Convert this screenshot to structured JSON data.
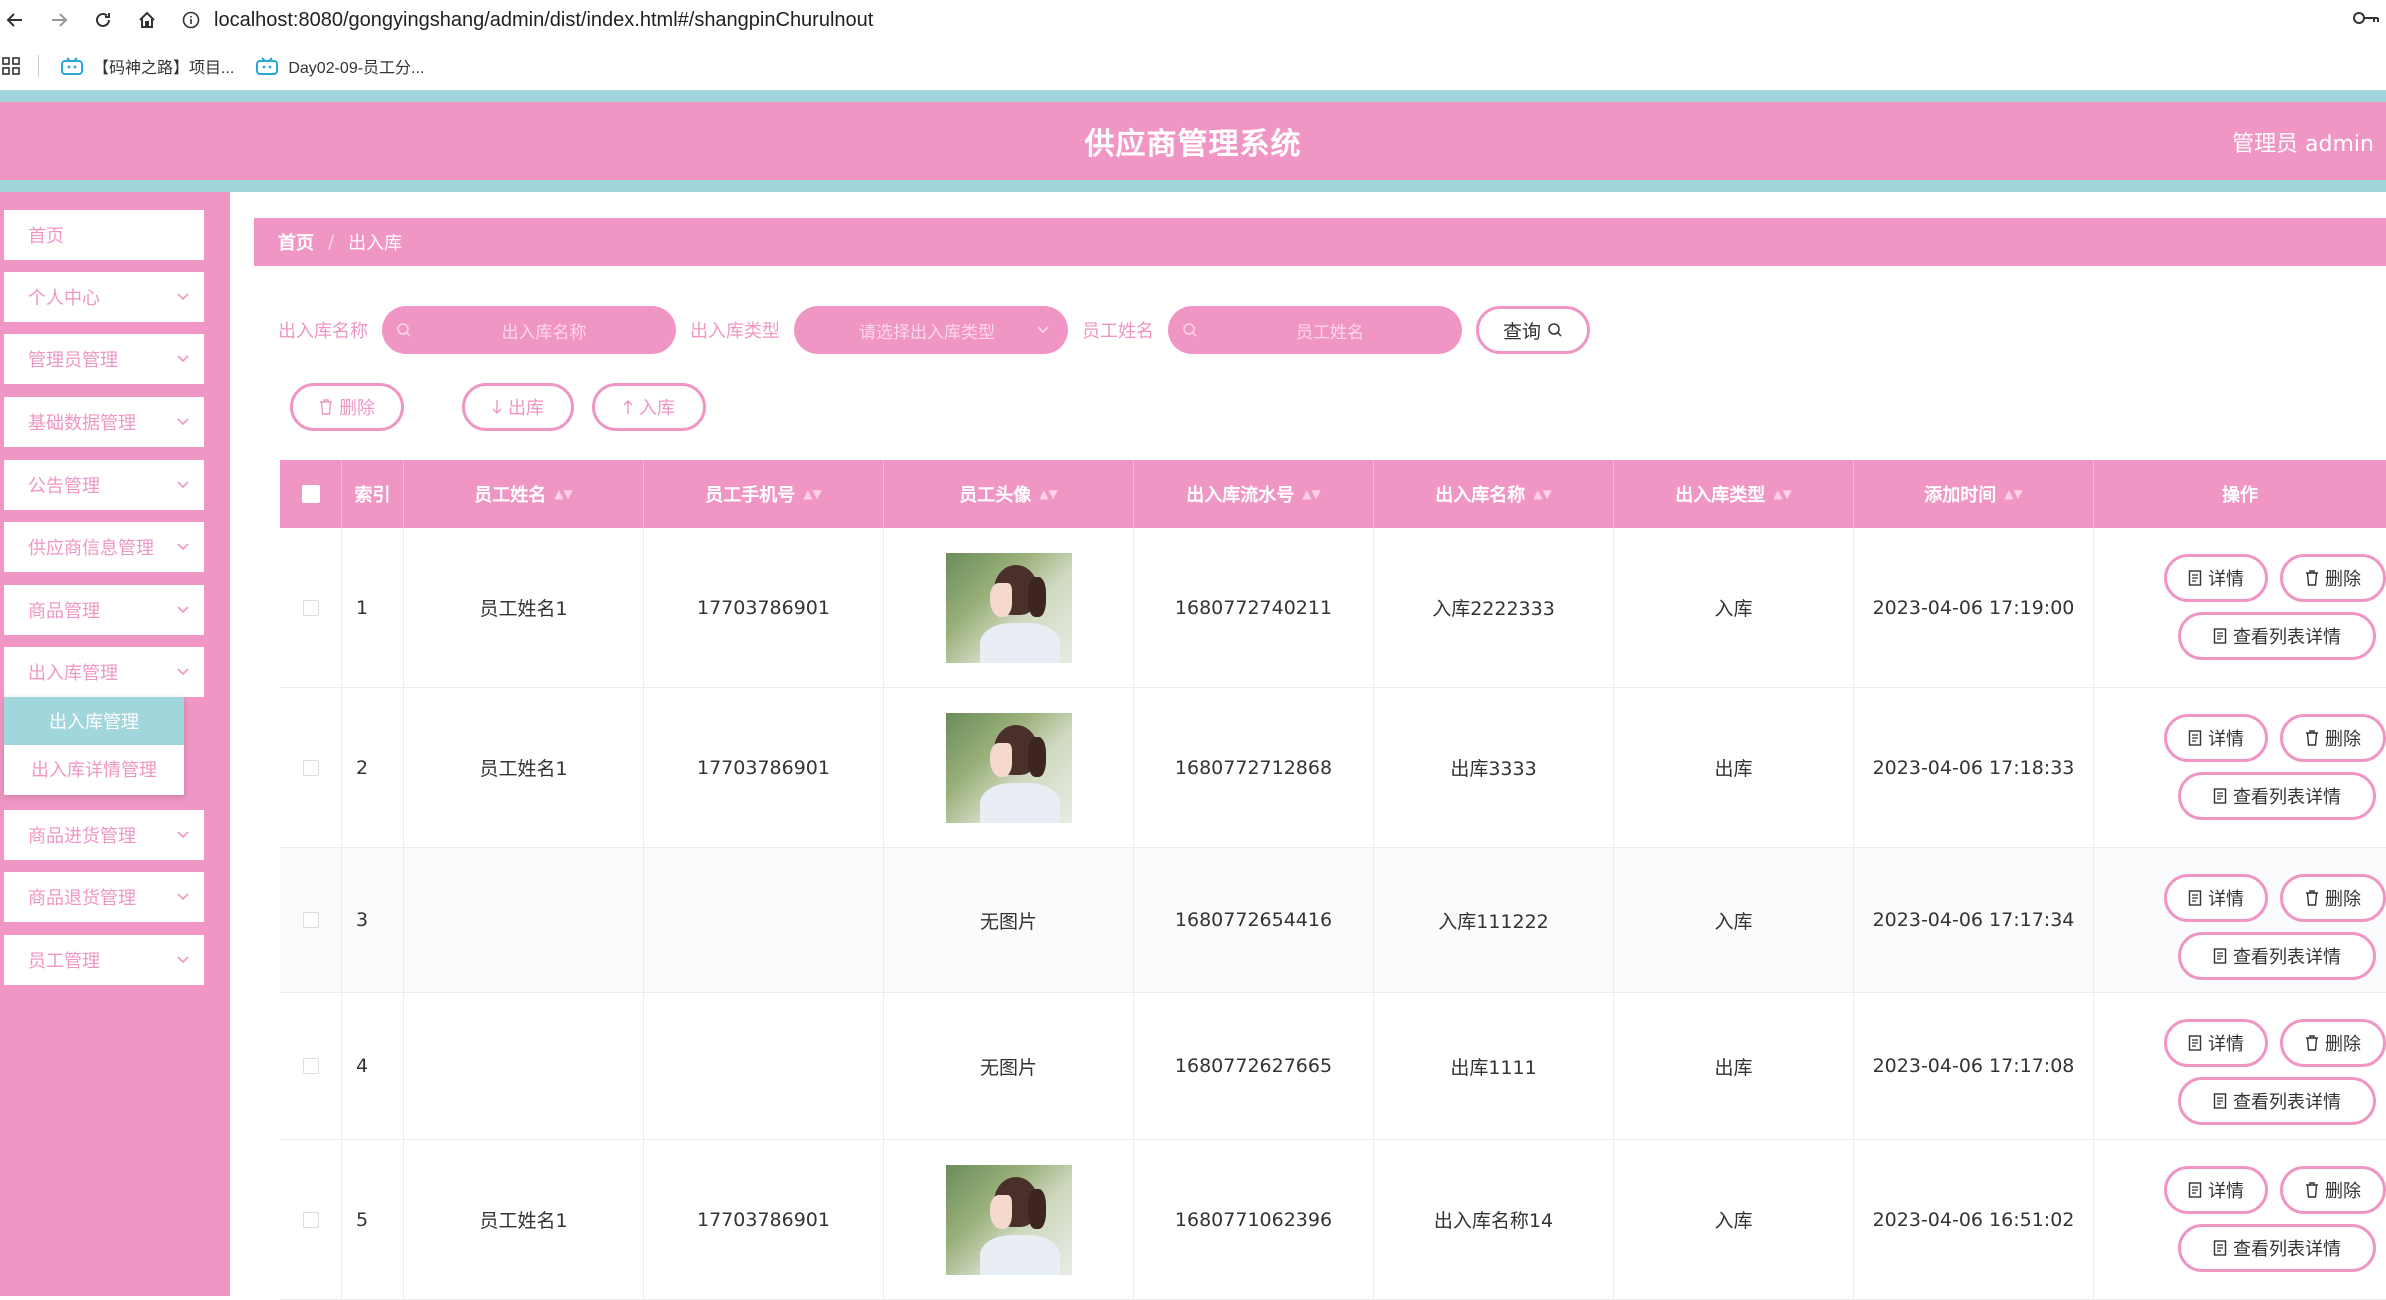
{
  "browser": {
    "url": "localhost:8080/gongyingshang/admin/dist/index.html#/shangpinChurulnout",
    "bookmarks": [
      "【码神之路】项目...",
      "Day02-09-员工分..."
    ]
  },
  "header": {
    "title": "供应商管理系统",
    "admin": "管理员 admin"
  },
  "sidebar": {
    "items": [
      "首页",
      "个人中心",
      "管理员管理",
      "基础数据管理",
      "公告管理",
      "供应商信息管理",
      "商品管理",
      "出入库管理",
      "商品进货管理",
      "商品退货管理",
      "员工管理"
    ],
    "submenu": [
      "出入库管理",
      "出入库详情管理"
    ]
  },
  "breadcrumb": {
    "home": "首页",
    "sep": "/",
    "current": "出入库"
  },
  "search": {
    "name_label": "出入库名称",
    "name_placeholder": "出入库名称",
    "type_label": "出入库类型",
    "type_placeholder": "请选择出入库类型",
    "staff_label": "员工姓名",
    "staff_placeholder": "员工姓名",
    "query_label": "查询"
  },
  "actions": {
    "delete": "删除",
    "out": "出库",
    "in": "入库"
  },
  "table": {
    "headers": [
      "索引",
      "员工姓名",
      "员工手机号",
      "员工头像",
      "出入库流水号",
      "出入库名称",
      "出入库类型",
      "添加时间",
      "操作"
    ],
    "no_image": "无图片",
    "op_detail": "详情",
    "op_delete": "删除",
    "op_list": "查看列表详情",
    "rows": [
      {
        "index": "1",
        "name": "员工姓名1",
        "phone": "17703786901",
        "has_image": true,
        "serial": "1680772740211",
        "item": "入库2222333",
        "type": "入库",
        "time": "2023-04-06 17:19:00"
      },
      {
        "index": "2",
        "name": "员工姓名1",
        "phone": "17703786901",
        "has_image": true,
        "serial": "1680772712868",
        "item": "出库3333",
        "type": "出库",
        "time": "2023-04-06 17:18:33"
      },
      {
        "index": "3",
        "name": "",
        "phone": "",
        "has_image": false,
        "serial": "1680772654416",
        "item": "入库111222",
        "type": "入库",
        "time": "2023-04-06 17:17:34"
      },
      {
        "index": "4",
        "name": "",
        "phone": "",
        "has_image": false,
        "serial": "1680772627665",
        "item": "出库1111",
        "type": "出库",
        "time": "2023-04-06 17:17:08"
      },
      {
        "index": "5",
        "name": "员工姓名1",
        "phone": "17703786901",
        "has_image": true,
        "serial": "1680771062396",
        "item": "出入库名称14",
        "type": "入库",
        "time": "2023-04-06 16:51:02"
      }
    ]
  },
  "colors": {
    "accent": "#f096c4",
    "teal": "#a2d6dd"
  },
  "icons": {
    "back": "arrow-left-icon",
    "forward": "arrow-right-icon",
    "reload": "reload-icon",
    "home": "home-icon",
    "info": "info-icon",
    "key": "key-icon",
    "apps": "apps-grid-icon",
    "bookmark": "bilibili-icon",
    "search": "search-icon",
    "trash": "trash-icon",
    "doc": "document-icon",
    "chevron": "chevron-down-icon"
  }
}
